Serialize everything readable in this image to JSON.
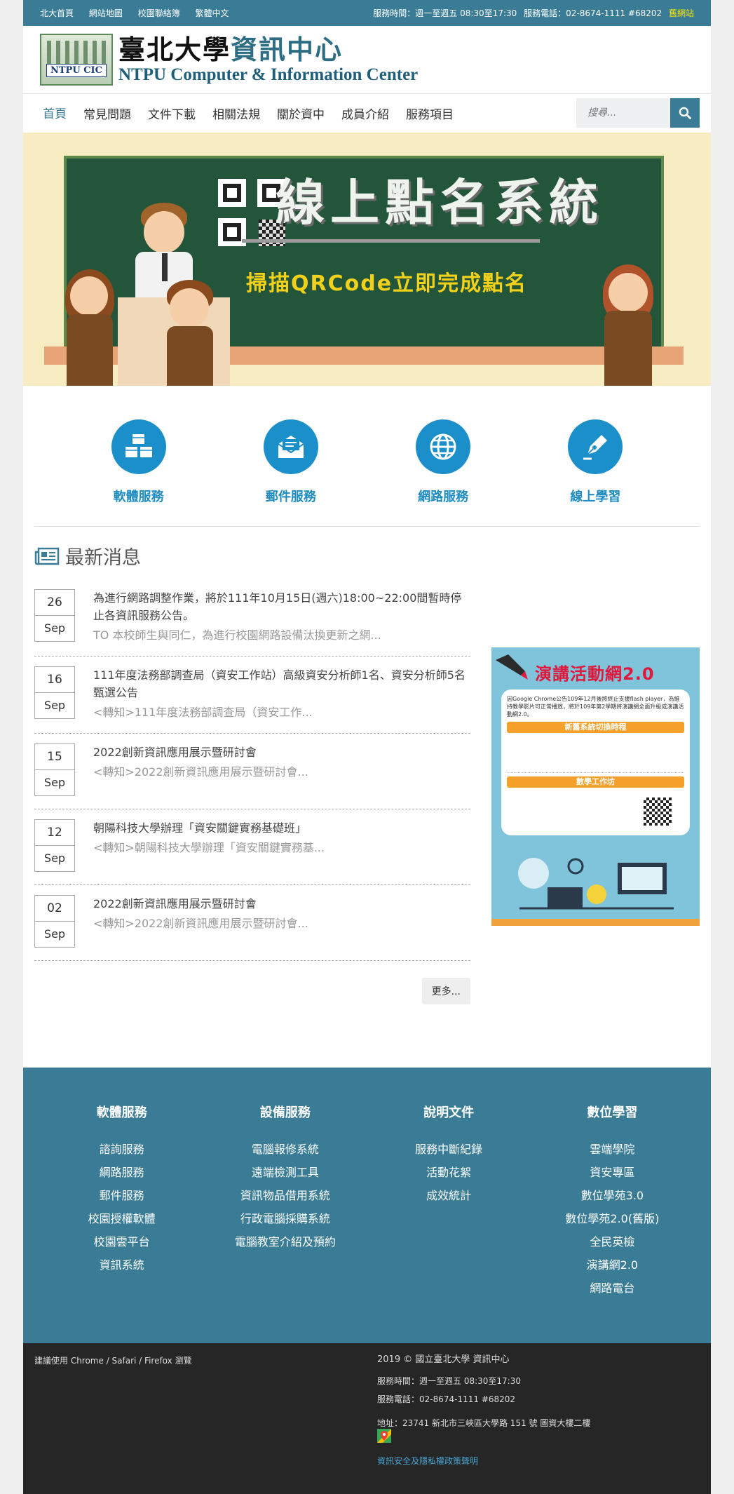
{
  "topbar": {
    "links": [
      "北大首頁",
      "網站地圖",
      "校園聯絡簿",
      "繁體中文"
    ],
    "hours": "服務時間：週一至週五 08:30至17:30",
    "phone": "服務電話：02-8674-1111 #68202",
    "old_site": "舊網站"
  },
  "logo": {
    "emblem_text": "NTPU CIC",
    "zh_black": "臺北大學",
    "zh_teal": "資訊中心",
    "en": "NTPU Computer & Information Center"
  },
  "nav": {
    "items": [
      "首頁",
      "常見問題",
      "文件下載",
      "相關法規",
      "關於資中",
      "成員介紹",
      "服務項目"
    ],
    "search_placeholder": "搜尋..."
  },
  "banner": {
    "title": "線上點名系統",
    "subtitle": "掃描QRCode立即完成點名"
  },
  "services": [
    "軟體服務",
    "郵件服務",
    "網路服務",
    "線上學習"
  ],
  "news": {
    "heading": "最新消息",
    "items": [
      {
        "day": "26",
        "month": "Sep",
        "title": "為進行網路調整作業，將於111年10月15日(週六)18:00~22:00間暫時停止各資訊服務公告。",
        "summary": "TO 本校師生與同仁，為進行校園網路設備汰換更新之網..."
      },
      {
        "day": "16",
        "month": "Sep",
        "title": "111年度法務部調查局（資安工作站）高級資安分析師1名、資安分析師5名甄選公告",
        "summary": "<轉知>111年度法務部調查局（資安工作..."
      },
      {
        "day": "15",
        "month": "Sep",
        "title": "2022創新資訊應用展示暨研討會",
        "summary": "<轉知>2022創新資訊應用展示暨研討會..."
      },
      {
        "day": "12",
        "month": "Sep",
        "title": "朝陽科技大學辦理「資安關鍵實務基礎班」",
        "summary": "<轉知>朝陽科技大學辦理「資安關鍵實務基..."
      },
      {
        "day": "02",
        "month": "Sep",
        "title": "2022創新資訊應用展示暨研討會",
        "summary": "<轉知>2022創新資訊應用展示暨研討會..."
      }
    ],
    "more": "更多..."
  },
  "poster": {
    "title": "演講活動網2.0",
    "intro": "因Google Chrome公告109年12月後將終止支援flash player，為維持教學影片可正常播放，將於109年第2學期將演講網全面升級成演講活動網2.0。",
    "bar1": "新舊系統切換時程",
    "bar2": "數學工作坊"
  },
  "footer": {
    "columns": [
      {
        "heading": "軟體服務",
        "links": [
          "諮詢服務",
          "網路服務",
          "郵件服務",
          "校園授權軟體",
          "校園雲平台",
          "資訊系統"
        ]
      },
      {
        "heading": "設備服務",
        "links": [
          "電腦報修系統",
          "遠端檢測工具",
          "資訊物品借用系統",
          "行政電腦採購系統",
          "電腦教室介紹及預約"
        ]
      },
      {
        "heading": "說明文件",
        "links": [
          "服務中斷紀錄",
          "活動花絮",
          "成效統計"
        ]
      },
      {
        "heading": "數位學習",
        "links": [
          "雲端學院",
          "資安專區",
          "數位學苑3.0",
          "數位學苑2.0(舊版)",
          "全民英檢",
          "演講網2.0",
          "網路電台"
        ]
      }
    ],
    "browser_note": "建議使用 Chrome / Safari / Firefox 瀏覽",
    "copyright": "2019 © 國立臺北大學 資訊中心",
    "hours": "服務時間：週一至週五 08:30至17:30",
    "phone": "服務電話：02-8674-1111 #68202",
    "address": "地址：23741 新北市三峽區大學路 151 號 圖資大樓二樓",
    "privacy": "資訊安全及隱私權政策聲明"
  },
  "colors": {
    "brand": "#3a7c96",
    "service_blue": "#1b8fca",
    "footer_dark": "#262626"
  }
}
